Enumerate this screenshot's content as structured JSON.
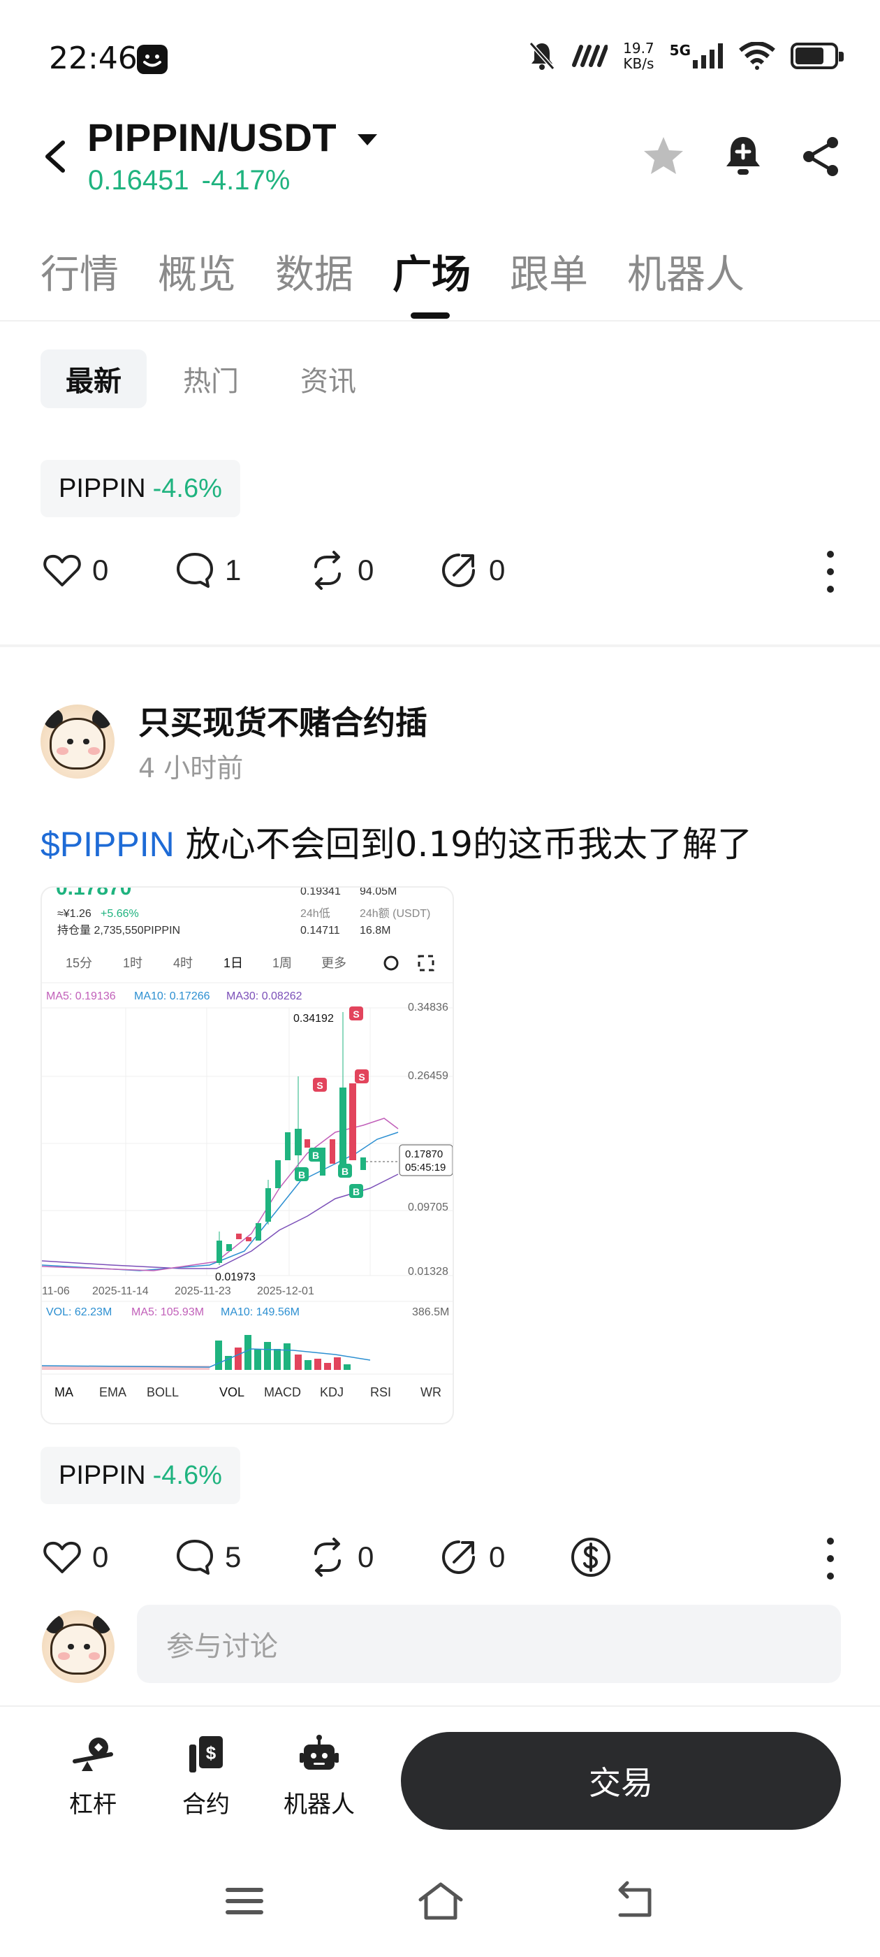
{
  "status_bar": {
    "time": "22:46",
    "net_speed_value": "19.7",
    "net_speed_unit": "KB/s",
    "signal": "5G",
    "icons": [
      "mute-icon",
      "nfc-icon",
      "signal-icon",
      "wifi-icon",
      "battery-icon"
    ]
  },
  "header": {
    "pair": "PIPPIN/USDT",
    "price": "0.16451",
    "change": "-4.17%",
    "price_color": "#1fb37f"
  },
  "tabs": [
    {
      "label": "行情"
    },
    {
      "label": "概览"
    },
    {
      "label": "数据"
    },
    {
      "label": "广场"
    },
    {
      "label": "跟单"
    },
    {
      "label": "机器人"
    }
  ],
  "active_tab": "广场",
  "subtabs": [
    {
      "label": "最新"
    },
    {
      "label": "热门"
    },
    {
      "label": "资讯"
    }
  ],
  "post1": {
    "chip_symbol": "PIPPIN",
    "chip_change": "-4.6%",
    "likes": "0",
    "comments": "1",
    "reposts": "0",
    "shares": "0"
  },
  "post2": {
    "author": "只买现货不赌合约插",
    "time": "4 小时前",
    "tag": "$PIPPIN",
    "text": " 放心不会回到0.19的这币我太了解了",
    "chip_symbol": "PIPPIN",
    "chip_change": "-4.6%",
    "likes": "0",
    "comments": "5",
    "reposts": "0",
    "shares": "0",
    "image": {
      "top_partial": "0.17870",
      "hi_val": "0.19341",
      "vol_val": "94.05M",
      "cny_price": "≈¥1.26",
      "cny_change": "+5.66%",
      "holding": "持仓量 2,735,550PIPPIN",
      "low_label": "24h低",
      "low_val": "0.14711",
      "amount_label": "24h额 (USDT)",
      "amount_val": "16.8M",
      "intervals": [
        "15分",
        "1时",
        "4时",
        "1日",
        "1周",
        "更多"
      ],
      "ma5": "MA5: 0.19136",
      "ma10": "MA10: 0.17266",
      "ma30": "MA30: 0.08262",
      "peak": "0.34192",
      "trough": "0.01973",
      "y_ticks": [
        "0.34836",
        "0.26459",
        "0.09705",
        "0.01328"
      ],
      "last_price": "0.17870",
      "countdown": "05:45:19",
      "dates": [
        "11-06",
        "2025-11-14",
        "2025-11-23",
        "2025-12-01"
      ],
      "vol": "VOL: 62.23M",
      "vol_ma5": "MA5: 105.93M",
      "vol_ma10": "MA10: 149.56M",
      "vol_max": "386.5M",
      "indicators": [
        "MA",
        "EMA",
        "BOLL",
        "VOL",
        "MACD",
        "KDJ",
        "RSI",
        "WR"
      ]
    }
  },
  "comment_placeholder": "参与讨论",
  "bottom_nav": [
    {
      "label": "杠杆"
    },
    {
      "label": "合约"
    },
    {
      "label": "机器人"
    }
  ],
  "trade_button": "交易"
}
